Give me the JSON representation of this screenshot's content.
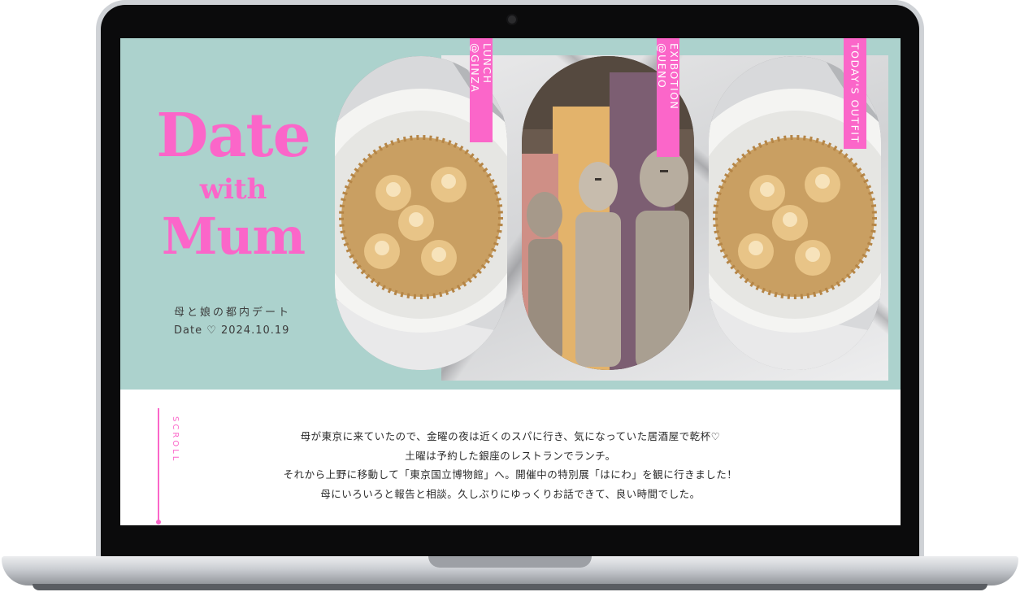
{
  "hero": {
    "title_line1": "Date",
    "title_line2": "with",
    "title_line3": "Mum",
    "subtitle": "母と娘の都内デート",
    "date_line": "Date  ♡  2024.10.19"
  },
  "cards": [
    {
      "label": "LUNCH @GINZA",
      "image": "dessert-bowl-photo"
    },
    {
      "label": "EXIBOTION @UENO",
      "image": "haniwa-statues-photo"
    },
    {
      "label": "TODAY'S OUTFIT",
      "image": "dessert-bowl-photo"
    }
  ],
  "scroll_label": "SCROLL",
  "article": {
    "lines": [
      "母が東京に来ていたので、金曜の夜は近くのスパに行き、気になっていた居酒屋で乾杯♡",
      "土曜は予約した銀座のレストランでランチ。",
      "それから上野に移動して「東京国立博物館」へ。開催中の特別展「はにわ」を観に行きました！",
      "母にいろいろと報告と相談。久しぶりにゆっくりお話できて、良い時間でした。"
    ]
  },
  "colors": {
    "accent_pink": "#fb66c9",
    "hero_mint": "#acd2cd",
    "text_dark": "#2a2a2a"
  }
}
